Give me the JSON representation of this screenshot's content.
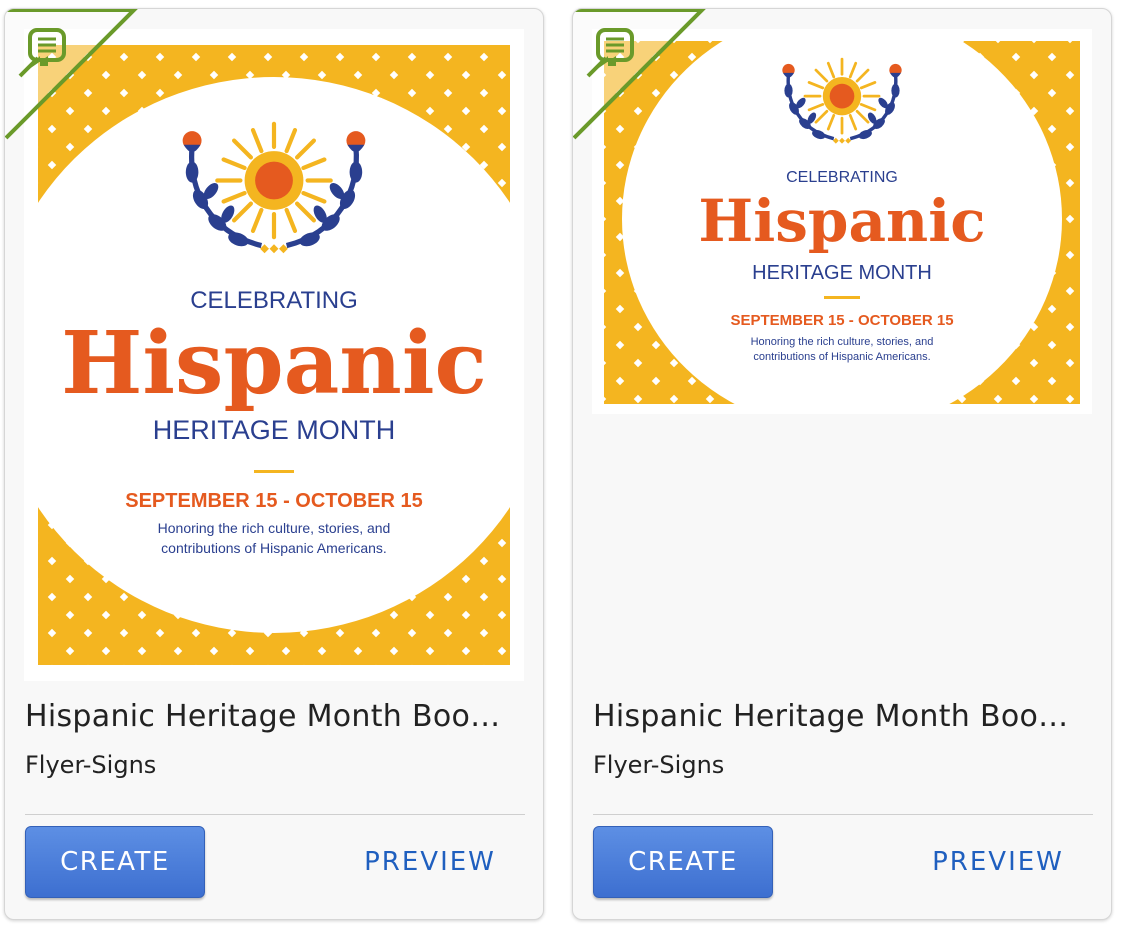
{
  "cards": [
    {
      "title": "Hispanic Heritage Month Boo…",
      "category": "Flyer-Signs",
      "create_label": "CREATE",
      "preview_label": "PREVIEW",
      "thumbnail": {
        "celebrating": "CELEBRATING",
        "headline": "Hispanic",
        "month": "HERITAGE MONTH",
        "dates": "SEPTEMBER 15 - OCTOBER 15",
        "tagline_1": "Honoring the rich culture, stories, and",
        "tagline_2": "contributions of Hispanic Americans."
      },
      "badge_icon": "document-arrow-icon"
    },
    {
      "title": "Hispanic Heritage Month Boo…",
      "category": "Flyer-Signs",
      "create_label": "CREATE",
      "preview_label": "PREVIEW",
      "thumbnail": {
        "celebrating": "CELEBRATING",
        "headline": "Hispanic",
        "month": "HERITAGE MONTH",
        "dates": "SEPTEMBER 15 - OCTOBER 15",
        "tagline_1": "Honoring the rich culture, stories, and",
        "tagline_2": "contributions of Hispanic Americans."
      },
      "badge_icon": "document-arrow-icon"
    }
  ],
  "colors": {
    "accent_yellow": "#f4b520",
    "headline_orange": "#e55a1f",
    "navy": "#2a3f8f",
    "badge_green": "#6a9a2a",
    "button_blue": "#4a7fdb",
    "link_blue": "#1f5fbf"
  }
}
